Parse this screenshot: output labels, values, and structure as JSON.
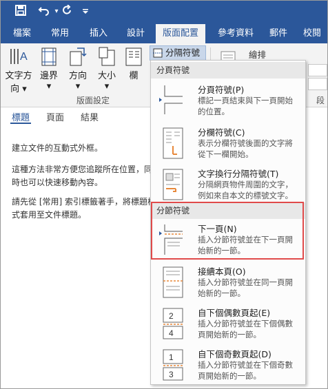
{
  "qat": {
    "save_icon": "save-icon",
    "undo_icon": "undo-icon",
    "redo_icon": "redo-icon",
    "customize_icon": "customize-icon"
  },
  "tabs": [
    {
      "label": "檔案"
    },
    {
      "label": "常用"
    },
    {
      "label": "插入"
    },
    {
      "label": "設計"
    },
    {
      "label": "版面配置"
    },
    {
      "label": "參考資料"
    },
    {
      "label": "郵件"
    },
    {
      "label": "校閱"
    }
  ],
  "ribbon": {
    "text_direction": {
      "line1": "文字方",
      "line2": "向 ▾"
    },
    "margins": {
      "label": "邊界",
      "caret": "▾"
    },
    "orientation": {
      "label": "方向",
      "caret": "▾"
    },
    "size": {
      "label": "大小",
      "caret": "▾"
    },
    "columns": {
      "label": "欄"
    },
    "group_label": "版面設定",
    "breaks_button": "分隔符號 ▾",
    "wrap_label": "繪排",
    "right_cut_label": "段"
  },
  "nav": {
    "tabs": [
      "標題",
      "頁面",
      "結果"
    ],
    "lines": [
      "建立文件的互動式外框。",
      "這種方法非常方便您追蹤所在位置，同",
      "時也可以快速移動內容。",
      "請先從 [常用] 索引標籤著手，將標題樣",
      "式套用至文件標題。"
    ]
  },
  "menu": {
    "page_breaks_header": "分頁符號",
    "section_breaks_header": "分節符號",
    "items": [
      {
        "title": "分頁符號(P)",
        "desc1": "標記一頁結束與下一頁開始",
        "desc2": "的位置。"
      },
      {
        "title": "分欄符號(C)",
        "desc1": "表示分欄符號後面的文字將",
        "desc2": "從下一欄開始。"
      },
      {
        "title": "文字換行分隔符號(T)",
        "desc1": "分隔網頁物件周圍的文字，",
        "desc2": "例如來自本文的標號文字。"
      },
      {
        "title": "下一頁(N)",
        "desc1": "插入分節符號並在下一頁開",
        "desc2": "始新的一節。"
      },
      {
        "title": "接續本頁(O)",
        "desc1": "插入分節符號並在同一頁開",
        "desc2": "始新的一節。"
      },
      {
        "title": "自下個偶數頁起(E)",
        "desc1": "插入分節符號並在下個偶數",
        "desc2": "頁開始新的一節。"
      },
      {
        "title": "自下個奇數頁起(D)",
        "desc1": "插入分節符號並在下個奇數",
        "desc2": "頁開始新的一節。"
      }
    ],
    "even_page_numbers": [
      "2",
      "4"
    ],
    "odd_page_numbers": [
      "1",
      "3"
    ]
  },
  "colors": {
    "title_bar": "#2b579a",
    "highlight": "#e04a4a",
    "accent_orange": "#e8883a"
  }
}
